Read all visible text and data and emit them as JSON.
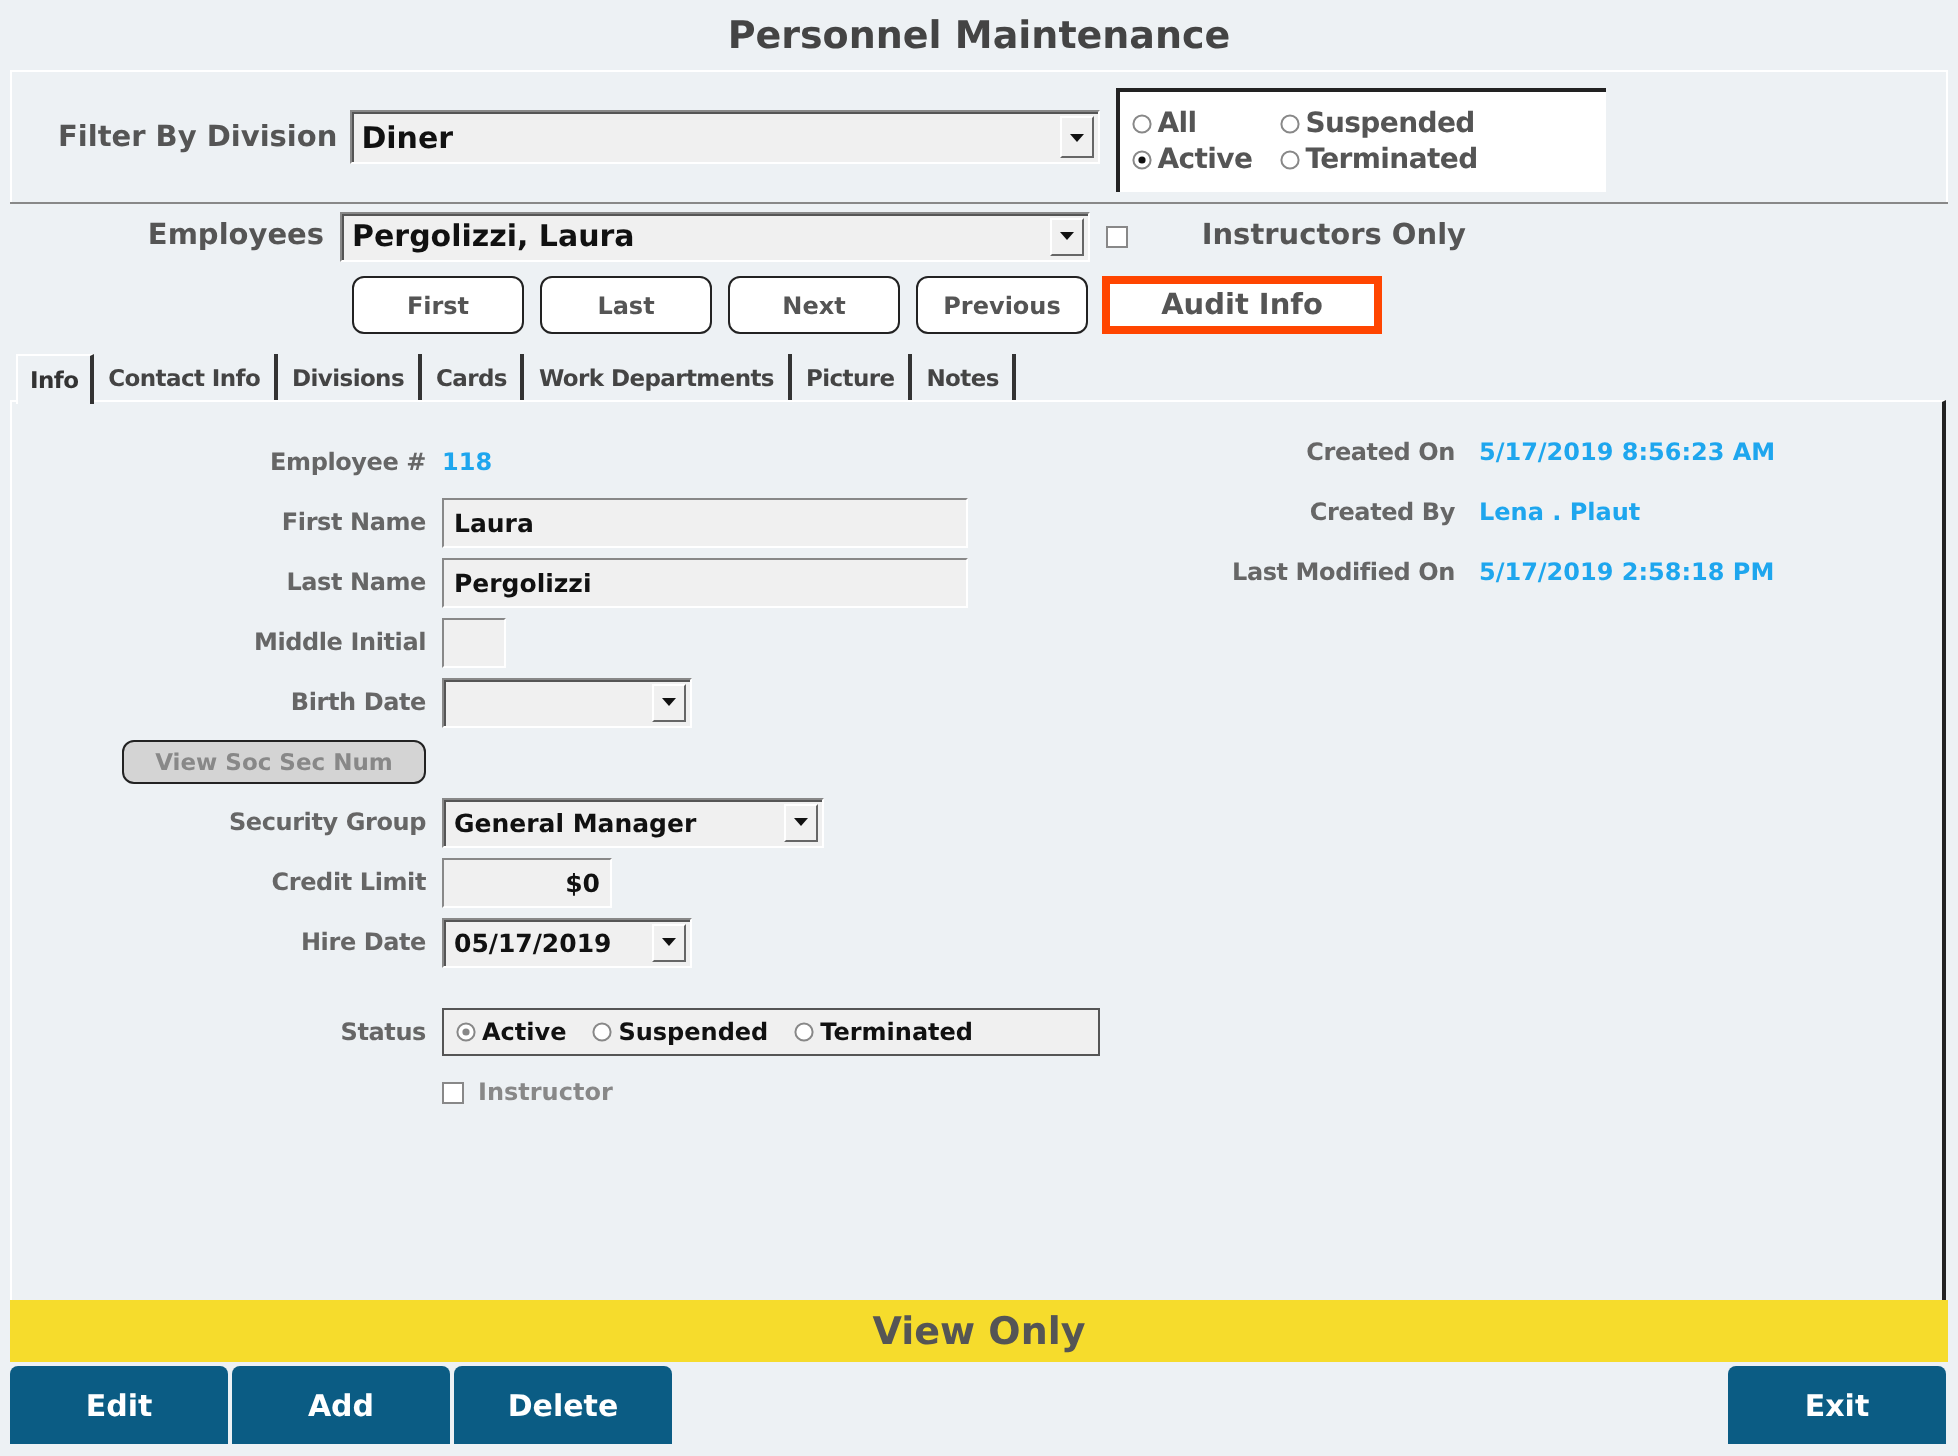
{
  "title": "Personnel Maintenance",
  "filter": {
    "label": "Filter By Division",
    "value": "Diner"
  },
  "status_filter": [
    {
      "label": "All",
      "selected": false
    },
    {
      "label": "Suspended",
      "selected": false
    },
    {
      "label": "Active",
      "selected": true
    },
    {
      "label": "Terminated",
      "selected": false
    }
  ],
  "employees": {
    "label": "Employees",
    "value": "Pergolizzi, Laura"
  },
  "instructors_only": {
    "label": "Instructors Only",
    "checked": false
  },
  "nav_buttons": [
    {
      "label": "First",
      "kind": "nav"
    },
    {
      "label": "Last",
      "kind": "nav"
    },
    {
      "label": "Next",
      "kind": "nav"
    },
    {
      "label": "Previous",
      "kind": "nav"
    },
    {
      "label": "Audit Info",
      "kind": "highlight"
    }
  ],
  "tabs": [
    {
      "label": "Info",
      "selected": true
    },
    {
      "label": "Contact Info",
      "selected": false
    },
    {
      "label": "Divisions",
      "selected": false
    },
    {
      "label": "Cards",
      "selected": false
    },
    {
      "label": "Work Departments",
      "selected": false
    },
    {
      "label": "Picture",
      "selected": false
    },
    {
      "label": "Notes",
      "selected": false
    }
  ],
  "fields": [
    {
      "kind": "value",
      "label": "Employee #",
      "value": "118"
    },
    {
      "kind": "text",
      "label": "First Name",
      "value": "Laura"
    },
    {
      "kind": "text",
      "label": "Last Name",
      "value": "Pergolizzi"
    },
    {
      "kind": "initial",
      "label": "Middle Initial"
    },
    {
      "kind": "date",
      "label": "Birth Date"
    },
    {
      "kind": "button",
      "label": "View Soc Sec Num",
      "disabled": true
    },
    {
      "kind": "combo",
      "label": "Security Group",
      "value": "General Manager"
    },
    {
      "kind": "amount",
      "label": "Credit Limit",
      "value": "$0"
    },
    {
      "kind": "date",
      "label": "Hire Date",
      "value": "05/17/2019"
    },
    {
      "kind": "radios",
      "label": "Status",
      "options": [
        {
          "label": "Active",
          "selected": true
        },
        {
          "label": "Suspended",
          "selected": false
        },
        {
          "label": "Terminated",
          "selected": false
        }
      ]
    },
    {
      "kind": "checkbox",
      "label": "Instructor",
      "checked": false,
      "disabled": true
    }
  ],
  "audit": [
    {
      "label": "Created On",
      "value": "5/17/2019 8:56:23 AM"
    },
    {
      "label": "Created By",
      "value": "Lena .  Plaut"
    },
    {
      "label": "Last Modified On",
      "value": "5/17/2019 2:58:18 PM"
    }
  ],
  "banner": "View Only",
  "actions": [
    {
      "label": "Edit",
      "kind": "left"
    },
    {
      "label": "Add",
      "kind": "left"
    },
    {
      "label": "Delete",
      "kind": "left"
    },
    {
      "label": "Exit",
      "kind": "right"
    }
  ]
}
